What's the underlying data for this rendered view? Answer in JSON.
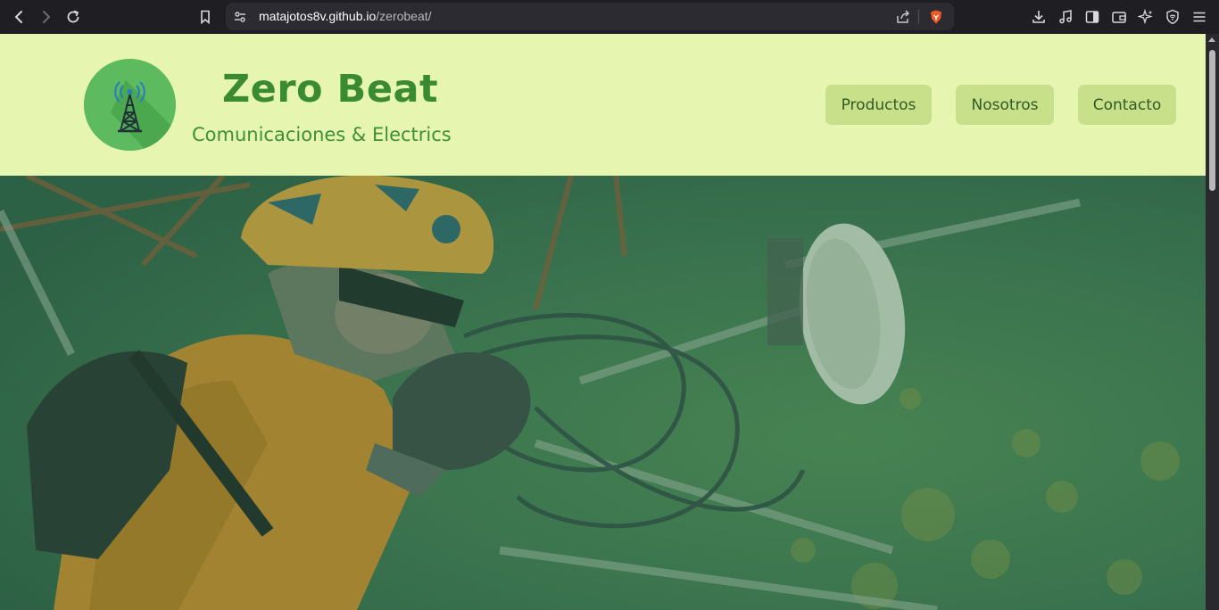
{
  "browser": {
    "url_host": "matajotos8v.github.io",
    "url_path": "/zerobeat/",
    "icons": [
      "back-icon",
      "forward-icon",
      "reload-icon",
      "bookmark-icon",
      "site-settings-icon",
      "share-icon",
      "brave-shield-icon",
      "download-icon",
      "media-icon",
      "sidebar-icon",
      "wallet-icon",
      "leo-ai-icon",
      "vpn-icon",
      "menu-icon"
    ]
  },
  "header": {
    "title": "Zero Beat",
    "subtitle": "Comunicaciones & Electrics",
    "logo_icon": "radio-tower-icon"
  },
  "nav": {
    "items": [
      {
        "label": "Productos"
      },
      {
        "label": "Nosotros"
      },
      {
        "label": "Contacto"
      }
    ]
  },
  "hero": {
    "image": "technician-climbing-telecom-tower"
  },
  "colors": {
    "header_bg": "#e6f6b0",
    "brand_green": "#3a8a32",
    "nav_button_bg": "#c9e08a",
    "hero_overlay": "#2f6e46"
  }
}
